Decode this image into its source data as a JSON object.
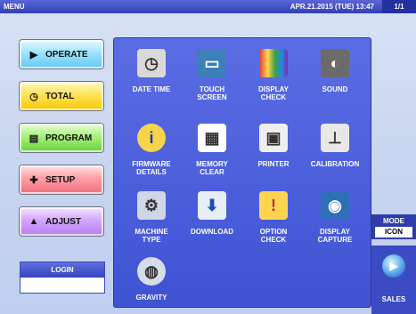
{
  "topbar": {
    "title": "MENU",
    "datetime": "APR.21.2015 (TUE) 13:47",
    "page": "1/1"
  },
  "left_menu": [
    {
      "label": "OPERATE",
      "icon": "play-circle-icon"
    },
    {
      "label": "TOTAL",
      "icon": "clock-icon"
    },
    {
      "label": "PROGRAM",
      "icon": "book-icon"
    },
    {
      "label": "SETUP",
      "icon": "wrench-icon"
    },
    {
      "label": "ADJUST",
      "icon": "triangle-adjust-icon"
    }
  ],
  "login": {
    "label": "LOGIN"
  },
  "tiles": [
    {
      "label1": "DATE TIME",
      "label2": "",
      "icon": "calendar-clock-icon"
    },
    {
      "label1": "TOUCH",
      "label2": "SCREEN",
      "icon": "touch-screen-icon"
    },
    {
      "label1": "DISPLAY",
      "label2": "CHECK",
      "icon": "display-check-icon"
    },
    {
      "label1": "SOUND",
      "label2": "",
      "icon": "speaker-icon"
    },
    {
      "label1": "FIRMWARE",
      "label2": "DETAILS",
      "icon": "info-icon"
    },
    {
      "label1": "MEMORY",
      "label2": "CLEAR",
      "icon": "memory-clear-icon"
    },
    {
      "label1": "PRINTER",
      "label2": "",
      "icon": "printer-icon"
    },
    {
      "label1": "CALIBRATION",
      "label2": "",
      "icon": "calibration-icon"
    },
    {
      "label1": "MACHINE",
      "label2": "TYPE",
      "icon": "gears-icon"
    },
    {
      "label1": "DOWNLOAD",
      "label2": "",
      "icon": "download-icon"
    },
    {
      "label1": "OPTION",
      "label2": "CHECK",
      "icon": "option-check-icon"
    },
    {
      "label1": "DISPLAY",
      "label2": "CAPTURE",
      "icon": "camera-icon"
    },
    {
      "label1": "GRAVITY",
      "label2": "",
      "icon": "globe-icon"
    }
  ],
  "mode": {
    "label": "MODE",
    "value": "ICON"
  },
  "sales": {
    "label": "SALES",
    "icon": "play-circle-icon"
  }
}
